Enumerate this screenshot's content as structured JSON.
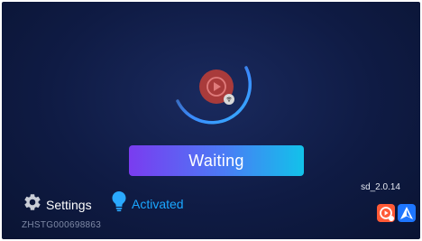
{
  "status": {
    "waiting_label": "Waiting"
  },
  "footer": {
    "settings_label": "Settings",
    "activation_label": "Activated",
    "device_id": "ZHSTG000698863",
    "version": "sd_2.0.14"
  },
  "icons": {
    "hero": "screen-mirroring-play-icon",
    "settings": "gear-icon",
    "activation": "lightbulb-icon",
    "app1": "cast-app-icon",
    "app2": "android-auto-icon"
  },
  "colors": {
    "background": "#0f1b44",
    "accent_blue": "#1aa7ff",
    "button_gradient_start": "#7a3cf0",
    "button_gradient_end": "#12c2ea",
    "play_circle": "#b23a3a"
  }
}
